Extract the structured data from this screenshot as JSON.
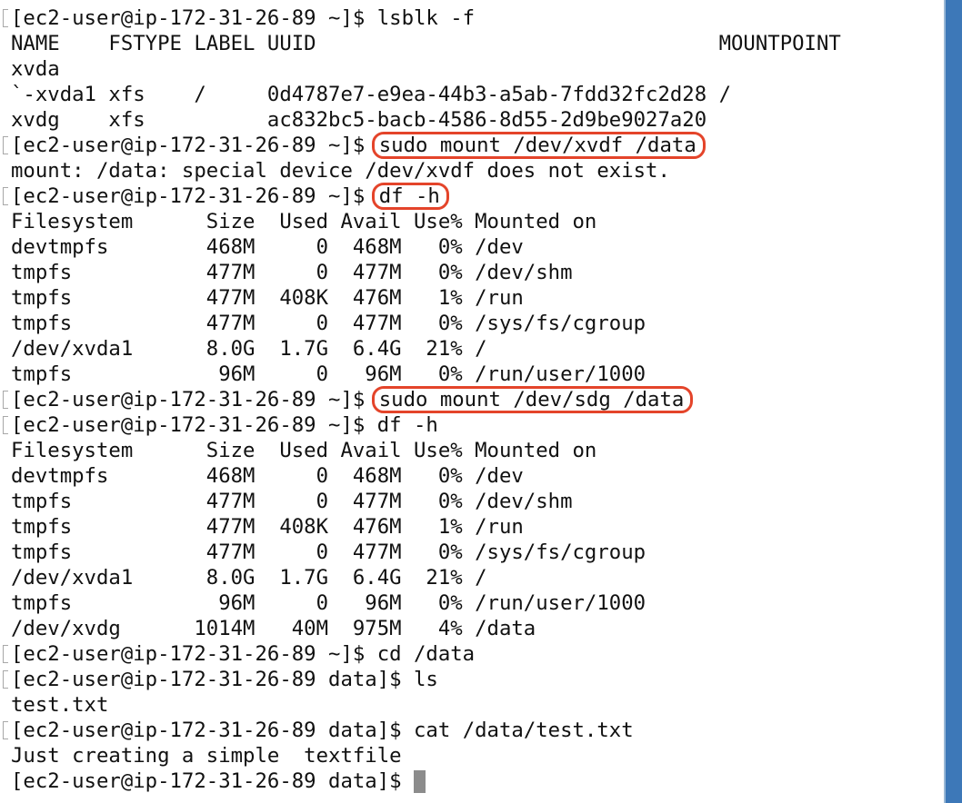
{
  "terminal": {
    "lines": [
      {
        "prompt": "[ec2-user@ip-172-31-26-89 ~]$ ",
        "text": "lsblk -f"
      },
      {
        "text": "NAME    FSTYPE LABEL UUID                                 MOUNTPOINT"
      },
      {
        "text": "xvda"
      },
      {
        "text": "`-xvda1 xfs    /     0d4787e7-e9ea-44b3-a5ab-7fdd32fc2d28 /"
      },
      {
        "text": "xvdg    xfs          ac832bc5-bacb-4586-8d55-2d9be9027a20"
      },
      {
        "prompt": "[ec2-user@ip-172-31-26-89 ~]$ ",
        "text": "sudo mount /dev/xvdf /data",
        "highlighted": true
      },
      {
        "text": "mount: /data: special device /dev/xvdf does not exist."
      },
      {
        "prompt": "[ec2-user@ip-172-31-26-89 ~]$ ",
        "text": "df -h",
        "highlighted": true
      },
      {
        "text": "Filesystem      Size  Used Avail Use% Mounted on"
      },
      {
        "text": "devtmpfs        468M     0  468M   0% /dev"
      },
      {
        "text": "tmpfs           477M     0  477M   0% /dev/shm"
      },
      {
        "text": "tmpfs           477M  408K  476M   1% /run"
      },
      {
        "text": "tmpfs           477M     0  477M   0% /sys/fs/cgroup"
      },
      {
        "text": "/dev/xvda1      8.0G  1.7G  6.4G  21% /"
      },
      {
        "text": "tmpfs            96M     0   96M   0% /run/user/1000"
      },
      {
        "prompt": "[ec2-user@ip-172-31-26-89 ~]$ ",
        "text": "sudo mount /dev/sdg /data",
        "highlighted": true
      },
      {
        "prompt": "[ec2-user@ip-172-31-26-89 ~]$ ",
        "text": "df -h"
      },
      {
        "text": "Filesystem      Size  Used Avail Use% Mounted on"
      },
      {
        "text": "devtmpfs        468M     0  468M   0% /dev"
      },
      {
        "text": "tmpfs           477M     0  477M   0% /dev/shm"
      },
      {
        "text": "tmpfs           477M  408K  476M   1% /run"
      },
      {
        "text": "tmpfs           477M     0  477M   0% /sys/fs/cgroup"
      },
      {
        "text": "/dev/xvda1      8.0G  1.7G  6.4G  21% /"
      },
      {
        "text": "tmpfs            96M     0   96M   0% /run/user/1000"
      },
      {
        "text": "/dev/xvdg      1014M   40M  975M   4% /data"
      },
      {
        "prompt": "[ec2-user@ip-172-31-26-89 ~]$ ",
        "text": "cd /data"
      },
      {
        "prompt": "[ec2-user@ip-172-31-26-89 data]$ ",
        "text": "ls"
      },
      {
        "text": "test.txt"
      },
      {
        "prompt": "[ec2-user@ip-172-31-26-89 data]$ ",
        "text": "cat /data/test.txt"
      },
      {
        "text": "Just creating a simple  textfile"
      },
      {
        "prompt": "[ec2-user@ip-172-31-26-89 data]$ ",
        "text": "",
        "cursor": true
      }
    ]
  },
  "colors": {
    "highlight_ring": "#e4442a",
    "text": "#111111",
    "cursor": "#8c8c8c",
    "window_edge": "#3d78b8"
  }
}
